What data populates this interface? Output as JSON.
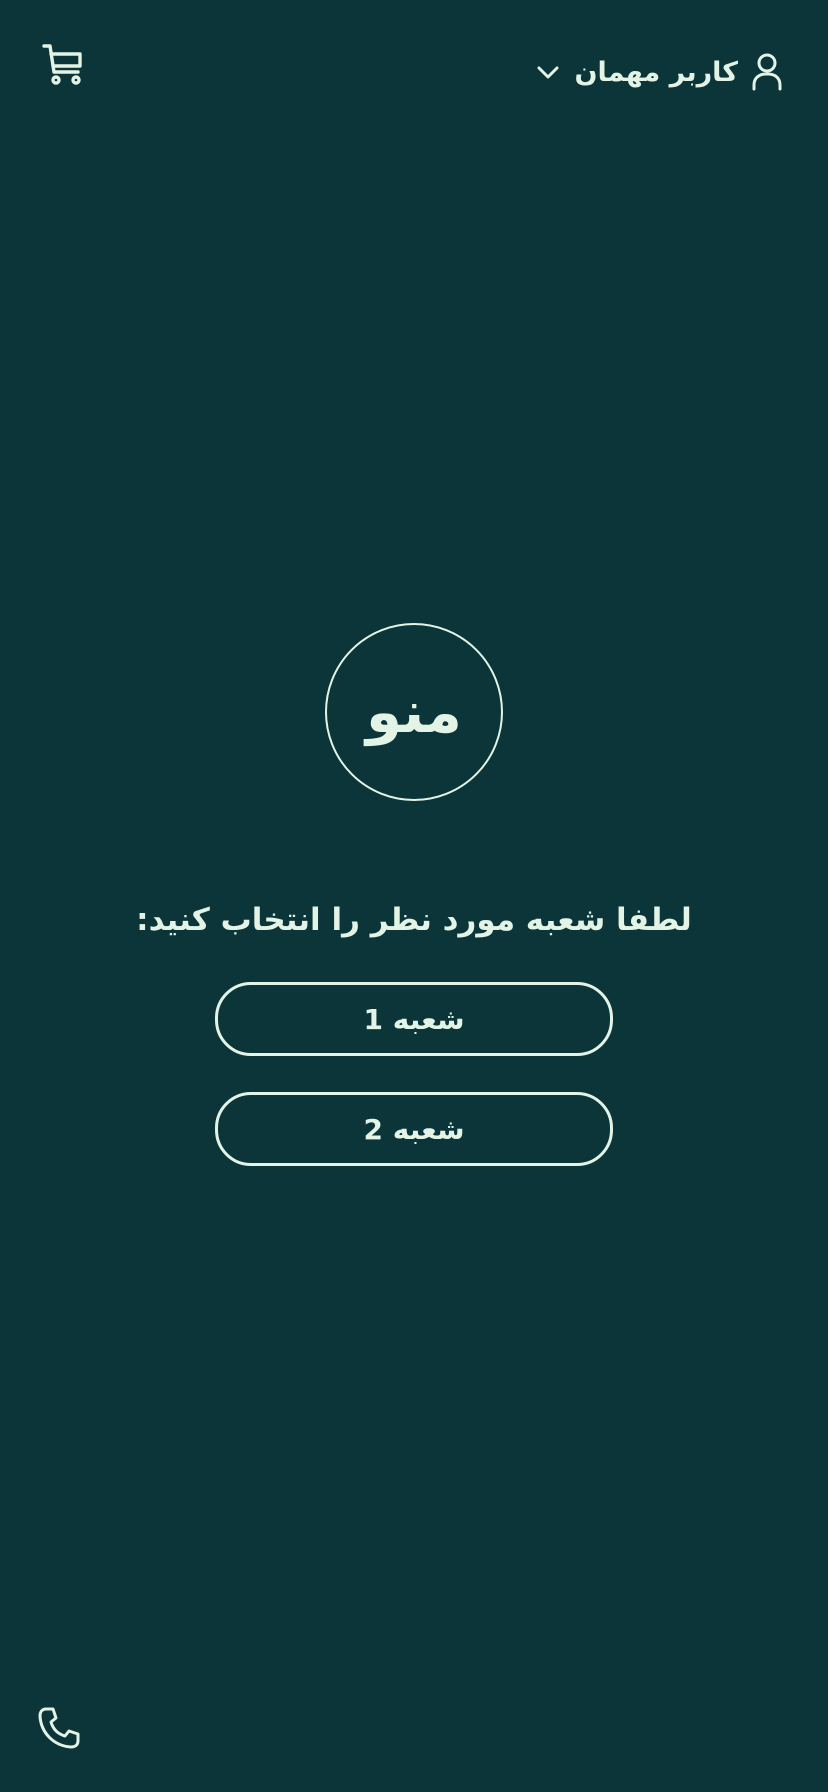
{
  "header": {
    "user_name": "کاربر مهمان",
    "user_icon": "user-icon",
    "dropdown_icon": "chevron-down-icon",
    "cart_icon": "cart-icon"
  },
  "logo": {
    "text": "منو",
    "icon": "logo-emblem"
  },
  "main": {
    "prompt": "لطفا شعبه مورد نظر را انتخاب کنید:",
    "branches": [
      {
        "label": "شعبه 1"
      },
      {
        "label": "شعبه 2"
      }
    ]
  },
  "footer": {
    "phone_icon": "phone-icon"
  },
  "colors": {
    "background": "#0b3538",
    "foreground": "#e3f4e6"
  }
}
